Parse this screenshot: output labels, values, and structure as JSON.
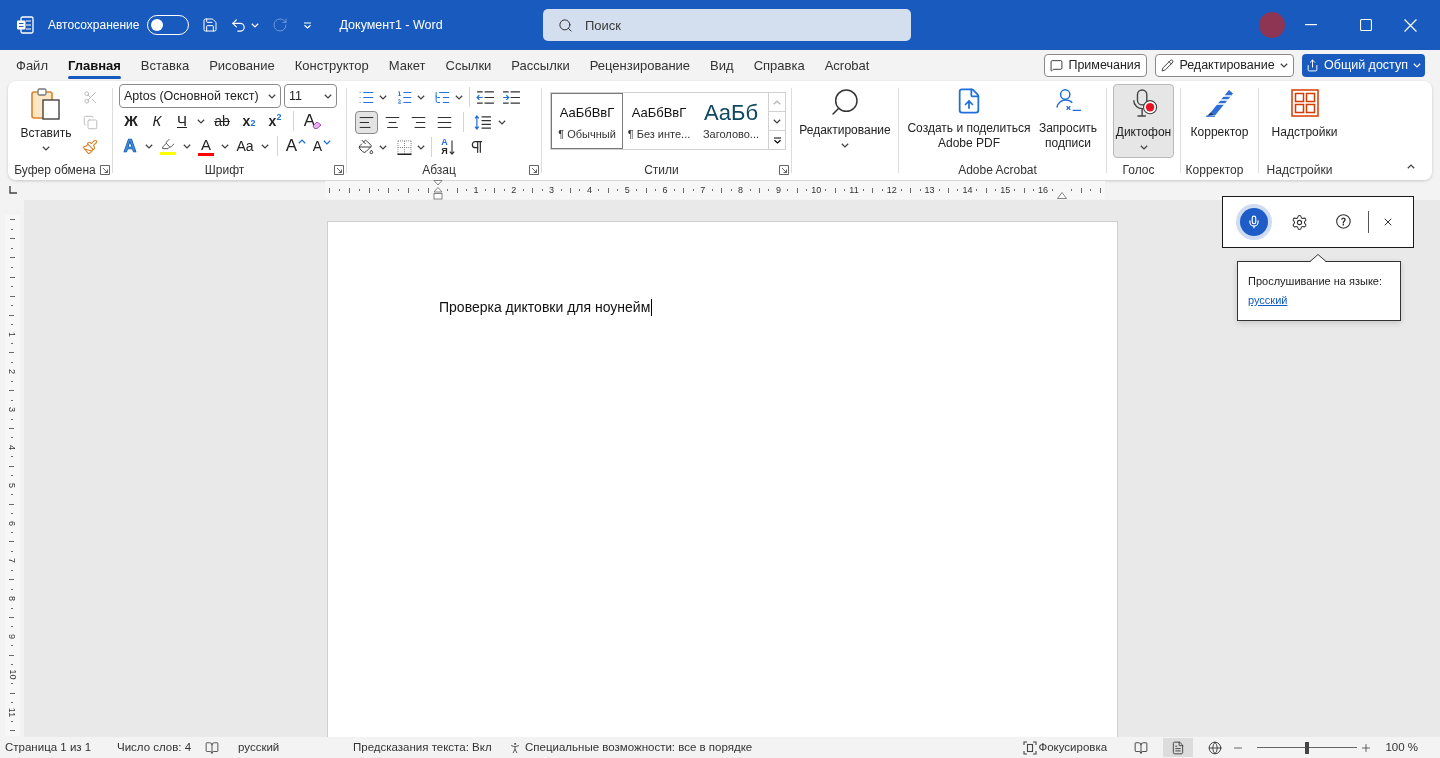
{
  "title_bar": {
    "autosave": {
      "label": "Автосохранение",
      "on": false
    },
    "quick_access": [
      {
        "kind": "save",
        "disabled": false
      },
      {
        "kind": "undo",
        "disabled": false
      },
      {
        "kind": "redo",
        "disabled": true
      },
      {
        "kind": "customize",
        "disabled": false
      }
    ],
    "document_title": "Документ1 - Word",
    "search": {
      "placeholder": "Поиск"
    }
  },
  "menu_tabs": [
    {
      "label": "Файл",
      "selected": false
    },
    {
      "label": "Главная",
      "selected": true
    },
    {
      "label": "Вставка",
      "selected": false
    },
    {
      "label": "Рисование",
      "selected": false
    },
    {
      "label": "Конструктор",
      "selected": false
    },
    {
      "label": "Макет",
      "selected": false
    },
    {
      "label": "Ссылки",
      "selected": false
    },
    {
      "label": "Рассылки",
      "selected": false
    },
    {
      "label": "Рецензирование",
      "selected": false
    },
    {
      "label": "Вид",
      "selected": false
    },
    {
      "label": "Справка",
      "selected": false
    },
    {
      "label": "Acrobat",
      "selected": false
    }
  ],
  "header_buttons": [
    {
      "kind": "comments",
      "label": "Примечания"
    },
    {
      "kind": "editing",
      "label": "Редактирование"
    },
    {
      "kind": "share",
      "label": "Общий доступ"
    }
  ],
  "ribbon": {
    "clipboard": {
      "paste_label": "Вставить",
      "tools": [
        {
          "kind": "cut",
          "disabled": true
        },
        {
          "kind": "copy",
          "disabled": true
        },
        {
          "kind": "format_painter",
          "disabled": false
        }
      ],
      "group_label": "Буфер обмена"
    },
    "font": {
      "font_name": "Aptos (Основной текст)",
      "font_size": "11",
      "row_1": [
        {
          "kind": "bold",
          "label": "Ж"
        },
        {
          "kind": "italic",
          "label": "К"
        },
        {
          "kind": "underline",
          "label": "Ч"
        },
        {
          "kind": "strikethrough",
          "label": "ab"
        },
        {
          "kind": "subscript",
          "label": "x$_{2}$"
        },
        {
          "kind": "superscript",
          "label": "x$^{2}$"
        },
        {
          "kind": "clear",
          "label": "A"
        }
      ],
      "row_2": [
        {
          "kind": "effects",
          "label": "A"
        },
        {
          "kind": "highlight",
          "color": "#ffff00"
        },
        {
          "kind": "font_color",
          "label": "A",
          "color": "#ff0000"
        },
        {
          "kind": "case",
          "label": "Aa"
        },
        {
          "kind": "grow",
          "label": "A"
        },
        {
          "kind": "shrink",
          "label": "A"
        }
      ],
      "group_label": "Шрифт"
    },
    "paragraph": {
      "alignment": [
        {
          "kind": "left",
          "selected": true
        },
        {
          "kind": "center",
          "selected": false
        },
        {
          "kind": "right",
          "selected": false
        },
        {
          "kind": "justify",
          "selected": false
        }
      ],
      "sort_letters": [
        "А",
        "Я"
      ],
      "group_label": "Абзац"
    },
    "styles": {
      "items": [
        {
          "kind": "normal",
          "sample": "АаБбВвГ",
          "name": "¶ Обычный",
          "selected": true
        },
        {
          "kind": "normal",
          "sample": "АаБбВвГ",
          "name": "¶ Без инте...",
          "selected": false
        },
        {
          "kind": "heading",
          "sample": "АаБб",
          "name": "Заголово...",
          "selected": false
        }
      ],
      "group_label": "Стили"
    },
    "editing": {
      "label": "Редактирование"
    },
    "acrobat": {
      "buttons": [
        {
          "kind": "create_pdf",
          "label_lines": [
            "Создать и поделиться",
            "Adobe PDF"
          ]
        },
        {
          "kind": "signatures",
          "label_lines": [
            "Запросить",
            "подписи"
          ]
        }
      ],
      "group_label": "Adobe Acrobat"
    },
    "voice": {
      "label": "Диктофон",
      "pressed": true,
      "group_label": "Голос"
    },
    "proofing": {
      "label": "Корректор",
      "group_label": "Корректор"
    },
    "addins": {
      "label": "Надстройки",
      "group_label": "Надстройки"
    }
  },
  "ruler": {
    "horizontal_marks": [
      "1",
      "2",
      "3",
      "4",
      "5",
      "6",
      "7",
      "8",
      "9",
      "10",
      "11",
      "12",
      "13",
      "14",
      "15",
      "16"
    ],
    "vertical_marks": [
      "1",
      "2",
      "3",
      "4",
      "5",
      "6",
      "7",
      "8",
      "9",
      "10",
      "11"
    ]
  },
  "document": {
    "text": "Проверка диктовки для ноунейм",
    "cursor": true
  },
  "dictation": {
    "listening": true,
    "tooltip_text": "Прослушивание на языке:",
    "language_link": "русский"
  },
  "status_bar": {
    "page": "Страница 1 из 1",
    "words": "Число слов: 4",
    "language": "русский",
    "predictions": "Предсказания текста: Вкл",
    "accessibility": "Специальные возможности: все в порядке",
    "focus": "Фокусировка",
    "views": [
      {
        "kind": "read",
        "selected": false
      },
      {
        "kind": "print",
        "selected": true
      },
      {
        "kind": "web",
        "selected": false
      }
    ],
    "zoom": {
      "level": 0.5,
      "reading": "100 %"
    }
  }
}
